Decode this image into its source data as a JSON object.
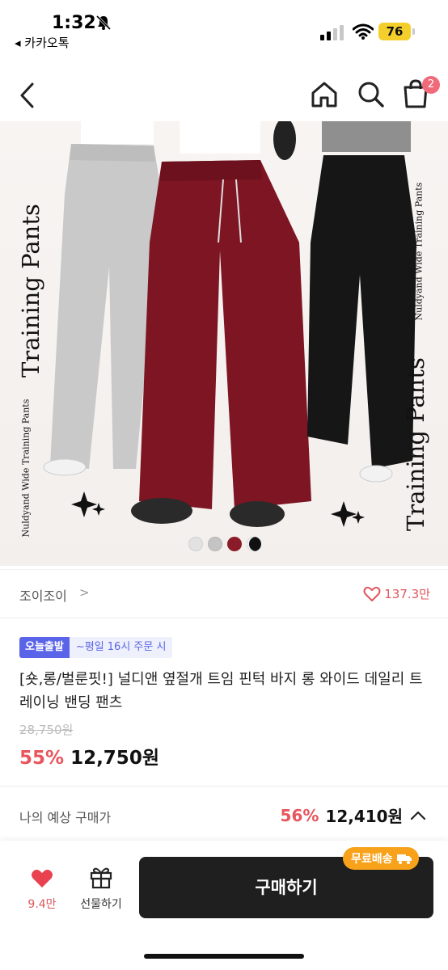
{
  "status_bar": {
    "time": "1:32",
    "back_app": "◂ 카카오톡",
    "battery": "76"
  },
  "nav": {
    "cart_count": "2"
  },
  "product_image": {
    "left_text": "Training Pants",
    "left_small": "Nuldyand Wide Training Pants",
    "right_text": "Training Pants",
    "right_small": "Nuldyand Wide Training Pants",
    "color_dots": [
      "#e2e2e2",
      "#c4c4c4",
      "#8a1b28",
      "#111111"
    ]
  },
  "seller": {
    "name": "조이조이",
    "chevron": ">",
    "likes": "137.3만"
  },
  "product": {
    "badge_today": "오늘출발",
    "badge_time": "~평일 16시 주문 시",
    "title": "[숏,롱/벌룬핏!] 널디앤 옆절개 트임 핀턱 바지 롱 와이드 데일리 트레이닝 밴딩 팬츠",
    "original_price": "28,750원",
    "discount": "55%",
    "price": "12,750원"
  },
  "estimate": {
    "label": "나의 예상 구매가",
    "discount": "56%",
    "price": "12,410원"
  },
  "bottom_bar": {
    "like_count": "9.4만",
    "gift_label": "선물하기",
    "buy_label": "구매하기",
    "free_ship": "무료배송"
  },
  "colors": {
    "accent_red": "#e8565d",
    "badge_blue": "#5a64e8",
    "orange": "#f7a21a"
  }
}
